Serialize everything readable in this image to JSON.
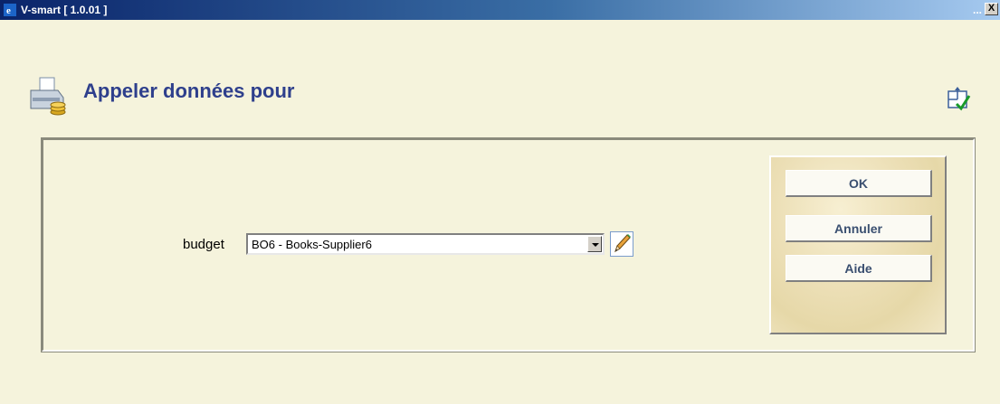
{
  "window": {
    "title": "V-smart [ 1.0.01 ]",
    "dots": "...",
    "close_label": "X"
  },
  "page": {
    "title": "Appeler données pour",
    "header_icon": "printer-coins-icon",
    "tool_icon": "layout-check-icon"
  },
  "form": {
    "budget_label": "budget",
    "budget_value": "BO6 - Books-Supplier6",
    "edit_icon": "pencil-icon"
  },
  "buttons": {
    "ok_label": "OK",
    "cancel_label": "Annuler",
    "help_label": "Aide"
  },
  "colors": {
    "background": "#f5f3dc",
    "title_text": "#2e3f8c",
    "titlebar_start": "#0a246a",
    "titlebar_end": "#a6caf0"
  }
}
